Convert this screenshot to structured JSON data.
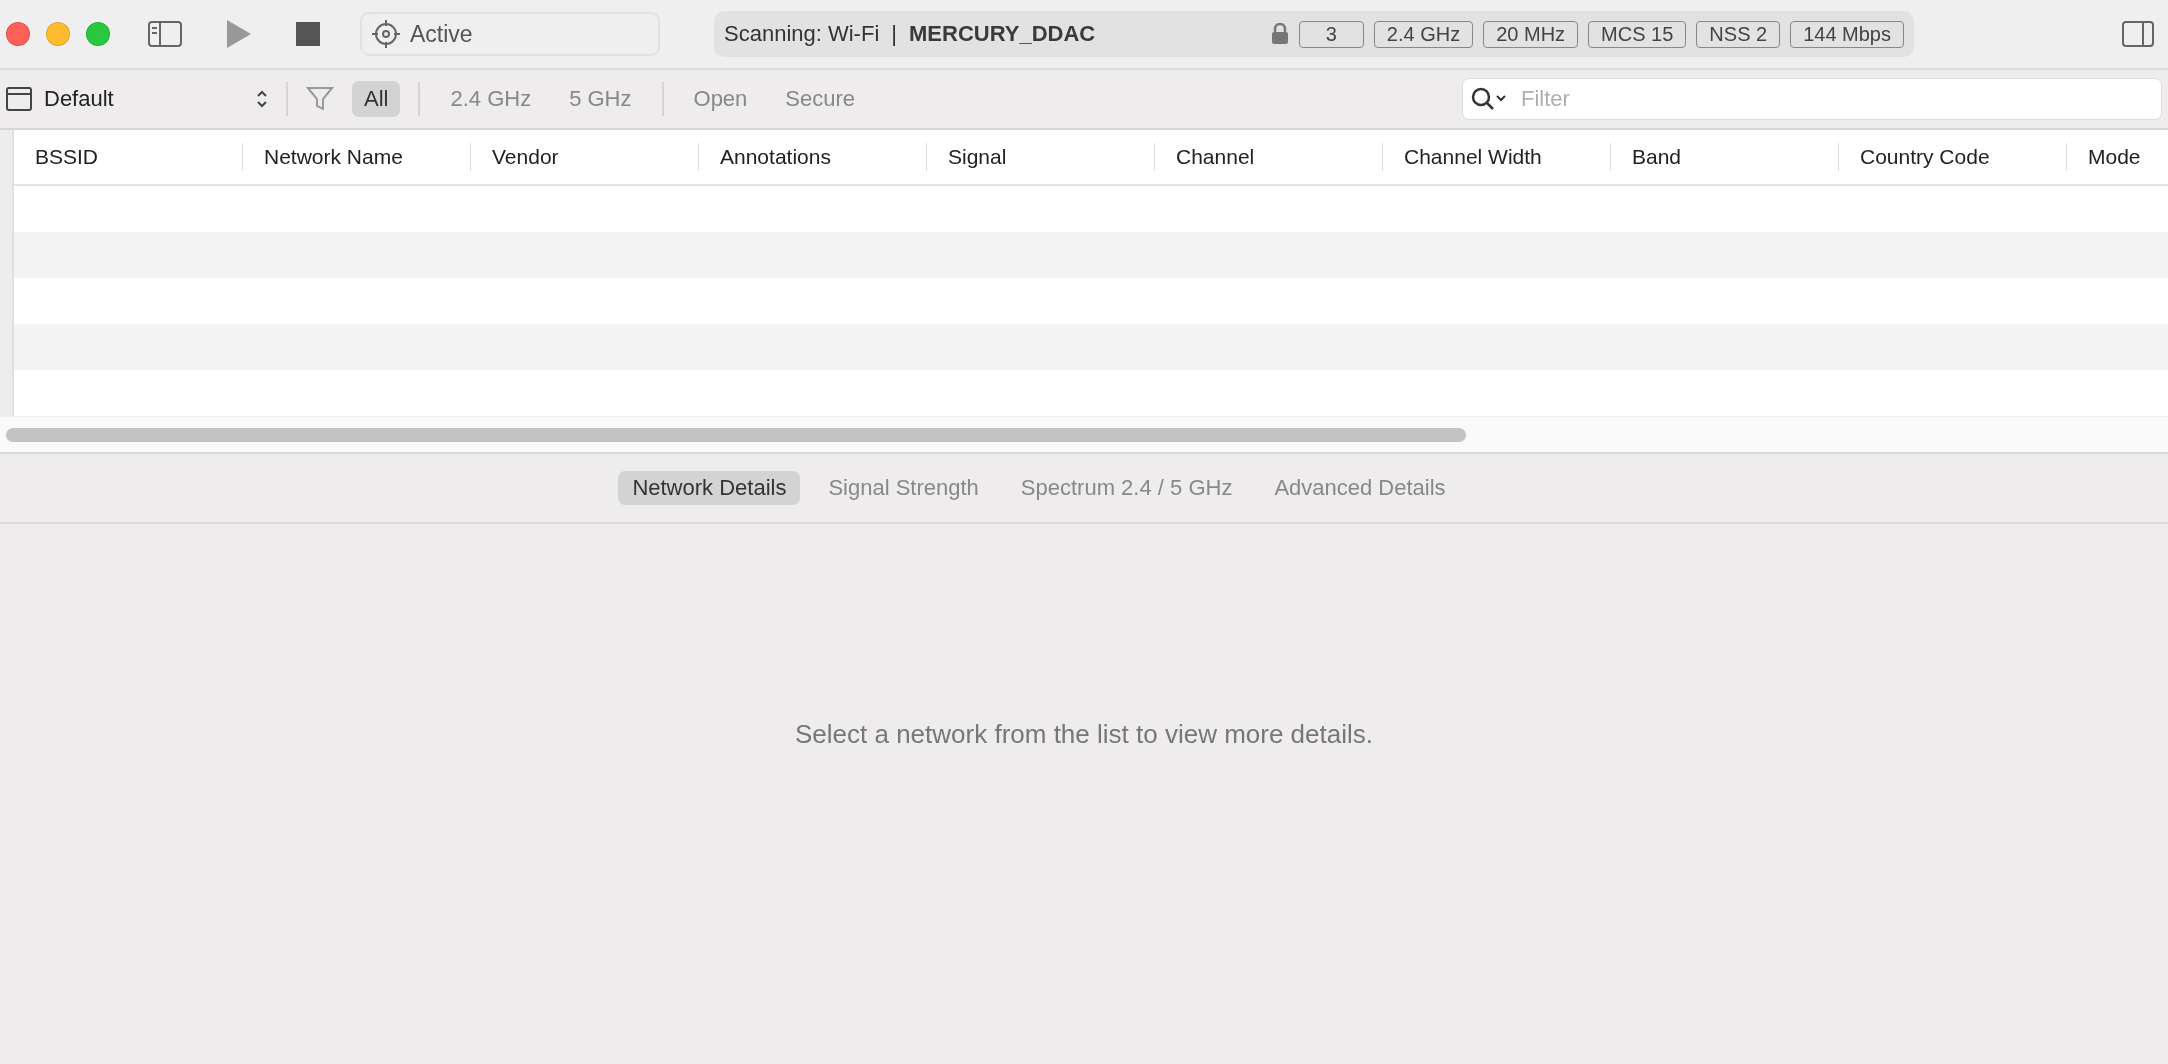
{
  "toolbar": {
    "mode_field": "Active",
    "scan_label": "Scanning: Wi-Fi",
    "separator": "|",
    "network_name": "MERCURY_DDAC",
    "badges": [
      "3",
      "2.4 GHz",
      "20 MHz",
      "MCS 15",
      "NSS 2",
      "144 Mbps"
    ]
  },
  "filter_bar": {
    "profile": "Default",
    "filters": [
      {
        "label": "All",
        "selected": true
      },
      {
        "label": "2.4 GHz",
        "selected": false
      },
      {
        "label": "5 GHz",
        "selected": false
      },
      {
        "label": "Open",
        "selected": false
      },
      {
        "label": "Secure",
        "selected": false
      }
    ],
    "search": {
      "placeholder": "Filter"
    }
  },
  "table": {
    "columns": [
      "BSSID",
      "Network Name",
      "Vendor",
      "Annotations",
      "Signal",
      "Channel",
      "Channel Width",
      "Band",
      "Country Code",
      "Mode"
    ]
  },
  "detail_tabs": [
    {
      "label": "Network Details",
      "selected": true
    },
    {
      "label": "Signal Strength",
      "selected": false
    },
    {
      "label": "Spectrum 2.4 / 5 GHz",
      "selected": false
    },
    {
      "label": "Advanced Details",
      "selected": false
    }
  ],
  "empty_message": "Select a network from the list to view more details."
}
